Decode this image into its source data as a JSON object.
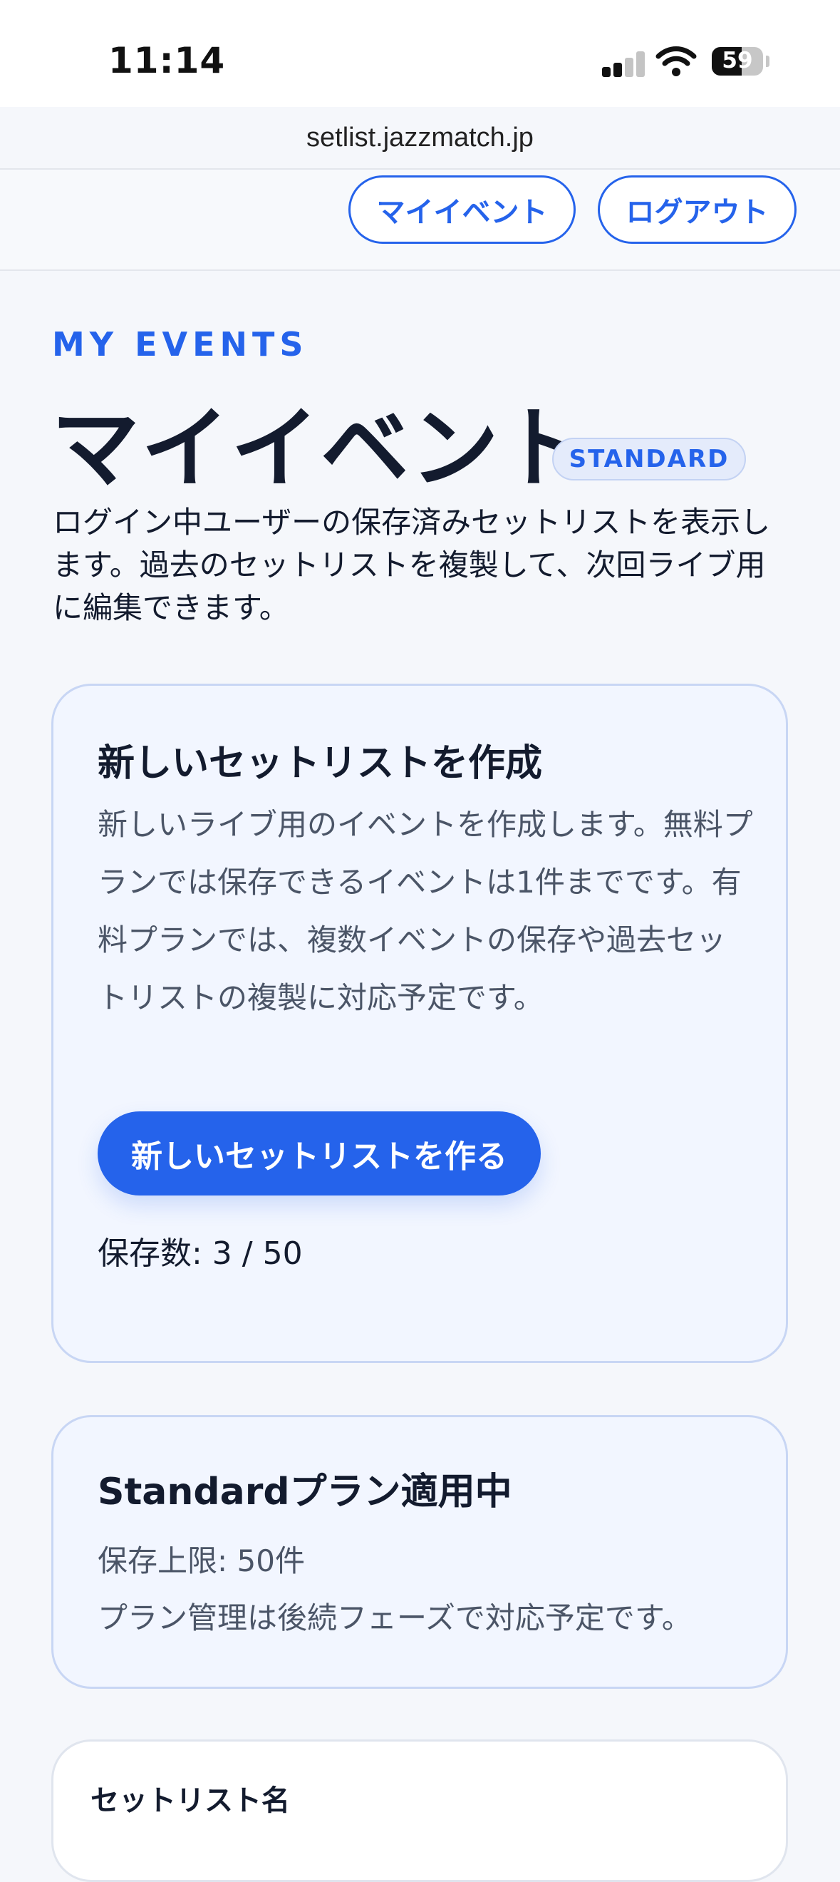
{
  "status_bar": {
    "time": "11:14",
    "battery_level": "59",
    "battery_fraction": 0.59,
    "signal_bars_active": 2,
    "signal_bars_total": 4
  },
  "browser": {
    "url": "setlist.jazzmatch.jp"
  },
  "nav": {
    "my_events_label": "マイイベント",
    "logout_label": "ログアウト"
  },
  "page": {
    "eyebrow": "MY EVENTS",
    "title": "マイイベント",
    "plan_badge": "STANDARD",
    "description": "ログイン中ユーザーの保存済みセットリストを表示します。過去のセットリストを複製して、次回ライブ用に編集できます。"
  },
  "create_card": {
    "title": "新しいセットリストを作成",
    "body": "新しいライブ用のイベントを作成します。無料プランでは保存できるイベントは1件までです。有料プランでは、複数イベントの保存や過去セットリストの複製に対応予定です。",
    "button_label": "新しいセットリストを作る",
    "save_count": "保存数: 3 / 50"
  },
  "plan_card": {
    "title": "Standardプラン適用中",
    "limit": "保存上限: 50件",
    "note": "プラン管理は後続フェーズで対応予定です。"
  },
  "setlist_table": {
    "column_name": "セットリスト名"
  },
  "colors": {
    "accent": "#2563eb",
    "text_dark": "#131b2e",
    "text_muted": "#4b5567",
    "card_bg": "#f2f6ff",
    "card_border": "#c8d6f4",
    "page_bg": "#f5f7fb"
  },
  "icons": {
    "signal": "cellular-signal-icon",
    "wifi": "wifi-icon",
    "battery": "battery-icon"
  }
}
